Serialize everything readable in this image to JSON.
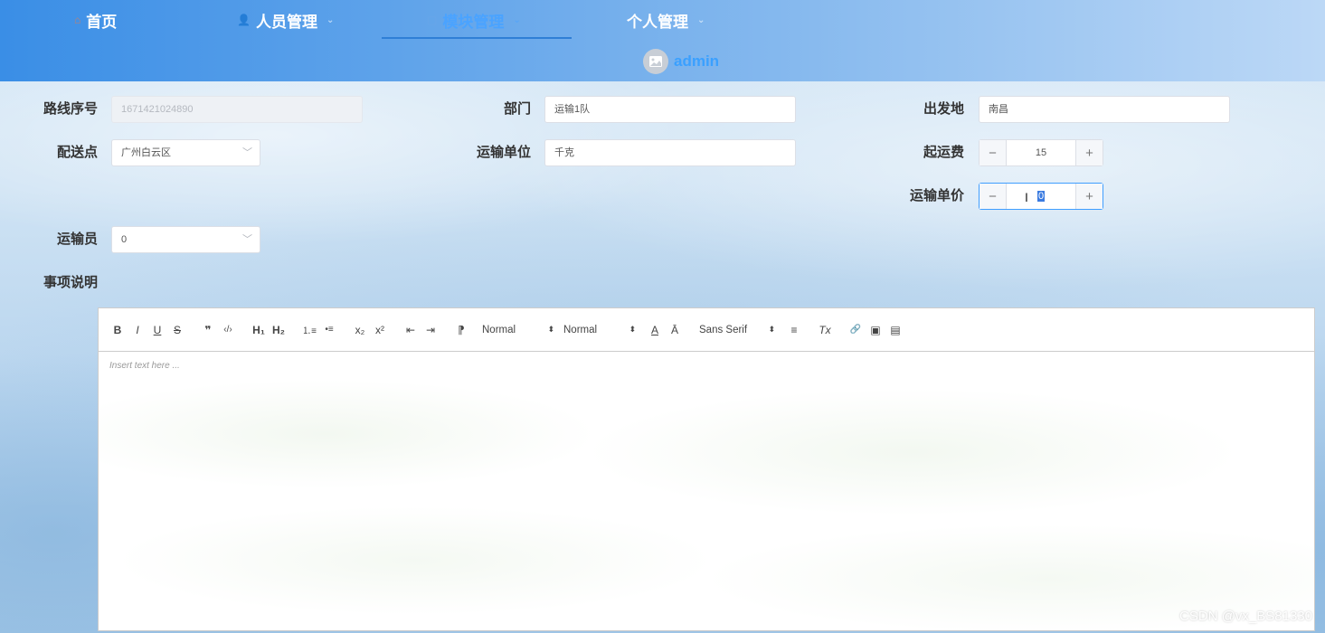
{
  "nav": {
    "items": [
      {
        "label": "首页",
        "icon": "home-icon"
      },
      {
        "label": "人员管理",
        "icon": "user-icon"
      },
      {
        "label": "模块管理",
        "icon": "module-icon"
      },
      {
        "label": "个人管理",
        "icon": ""
      }
    ],
    "active": "模块管理",
    "chevron": "⌄"
  },
  "user": {
    "name": "admin"
  },
  "form": {
    "route_no_label": "路线序号",
    "route_no_value": "1671421024890",
    "dept_label": "部门",
    "dept_value": "运输1队",
    "origin_label": "出发地",
    "origin_value": "南昌",
    "delivery_label": "配送点",
    "delivery_value": "广州白云区",
    "unit_label": "运输单位",
    "unit_value": "千克",
    "base_fee_label": "起运费",
    "base_fee_value": "15",
    "unit_price_label": "运输单价",
    "unit_price_value": "0",
    "carrier_label": "运输员",
    "carrier_value": "0",
    "notes_label": "事项说明",
    "minus": "−",
    "plus": "+"
  },
  "editor": {
    "tools": {
      "bold": "B",
      "italic": "I",
      "underline": "U",
      "strike": "S",
      "blockquote": "❞",
      "code": "‹/›",
      "h1": "H₁",
      "h2": "H₂",
      "ordered_list": "⒈≡",
      "bullet_list": "•≡",
      "subscript": "x₂",
      "superscript": "x²",
      "outdent": "⇤",
      "indent": "⇥",
      "direction": "⁋",
      "color": "A",
      "background": "Ā",
      "align": "≡",
      "clean": "Tx",
      "link": "🔗",
      "image": "▣",
      "video": "▤"
    },
    "size_picker": "Normal",
    "header_picker": "Normal",
    "font_picker": "Sans Serif",
    "picker_arrow": "⬍",
    "placeholder": "Insert text here ..."
  },
  "watermark": "CSDN @vx_BS81330",
  "colors": {
    "accent": "#409eff",
    "header_start": "#3a8ee6",
    "header_end": "#bcd8f6"
  }
}
